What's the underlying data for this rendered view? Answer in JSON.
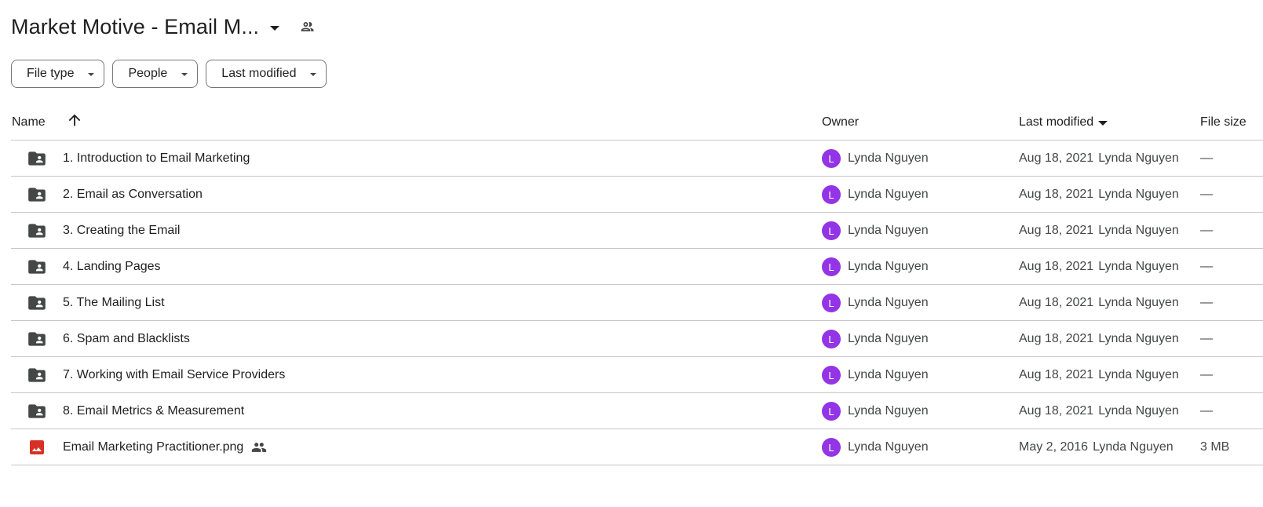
{
  "header": {
    "title": "Market Motive - Email M..."
  },
  "filters": [
    {
      "label": "File type"
    },
    {
      "label": "People"
    },
    {
      "label": "Last modified"
    }
  ],
  "table": {
    "columns": {
      "name": "Name",
      "owner": "Owner",
      "last_modified": "Last modified",
      "file_size": "File size"
    },
    "sort": {
      "column": "last_modified",
      "direction": "descending"
    },
    "rows": [
      {
        "type": "shared-folder",
        "name": "1. Introduction to Email Marketing",
        "owner_initial": "L",
        "owner": "Lynda Nguyen",
        "modified_date": "Aug 18, 2021",
        "modified_by": "Lynda Nguyen",
        "size": "—"
      },
      {
        "type": "shared-folder",
        "name": "2. Email as Conversation",
        "owner_initial": "L",
        "owner": "Lynda Nguyen",
        "modified_date": "Aug 18, 2021",
        "modified_by": "Lynda Nguyen",
        "size": "—"
      },
      {
        "type": "shared-folder",
        "name": "3. Creating the Email",
        "owner_initial": "L",
        "owner": "Lynda Nguyen",
        "modified_date": "Aug 18, 2021",
        "modified_by": "Lynda Nguyen",
        "size": "—"
      },
      {
        "type": "shared-folder",
        "name": "4. Landing Pages",
        "owner_initial": "L",
        "owner": "Lynda Nguyen",
        "modified_date": "Aug 18, 2021",
        "modified_by": "Lynda Nguyen",
        "size": "—"
      },
      {
        "type": "shared-folder",
        "name": "5. The Mailing List",
        "owner_initial": "L",
        "owner": "Lynda Nguyen",
        "modified_date": "Aug 18, 2021",
        "modified_by": "Lynda Nguyen",
        "size": "—"
      },
      {
        "type": "shared-folder",
        "name": "6. Spam and Blacklists",
        "owner_initial": "L",
        "owner": "Lynda Nguyen",
        "modified_date": "Aug 18, 2021",
        "modified_by": "Lynda Nguyen",
        "size": "—"
      },
      {
        "type": "shared-folder",
        "name": "7. Working with Email Service Providers",
        "owner_initial": "L",
        "owner": "Lynda Nguyen",
        "modified_date": "Aug 18, 2021",
        "modified_by": "Lynda Nguyen",
        "size": "—"
      },
      {
        "type": "shared-folder",
        "name": "8. Email Metrics & Measurement",
        "owner_initial": "L",
        "owner": "Lynda Nguyen",
        "modified_date": "Aug 18, 2021",
        "modified_by": "Lynda Nguyen",
        "size": "—"
      },
      {
        "type": "image",
        "name": "Email Marketing Practitioner.png",
        "shared": true,
        "owner_initial": "L",
        "owner": "Lynda Nguyen",
        "modified_date": "May 2, 2016",
        "modified_by": "Lynda Nguyen",
        "size": "3 MB"
      }
    ]
  },
  "colors": {
    "avatar": "#9334e6",
    "folder_icon": "#444746",
    "image_icon": "#d93025",
    "divider": "#c7c7c7",
    "chip_border": "#747775"
  },
  "icons": {
    "title_shared": "people-icon",
    "sort_name": "arrow-up-icon",
    "folder": "shared-folder-icon",
    "image": "image-file-icon",
    "file_shared": "people-icon"
  }
}
